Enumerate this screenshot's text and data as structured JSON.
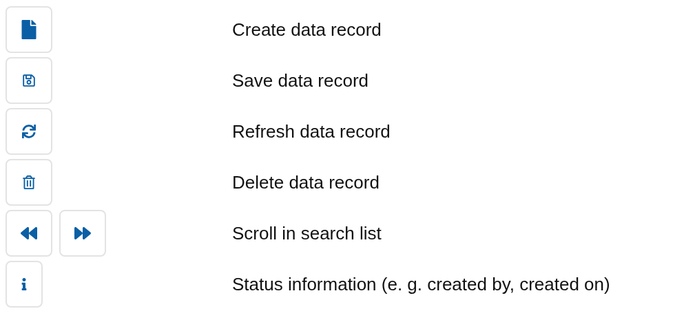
{
  "rows": [
    {
      "buttons": [
        {
          "kind": "new"
        }
      ],
      "label": "Create data record"
    },
    {
      "buttons": [
        {
          "kind": "save"
        }
      ],
      "label": "Save data record"
    },
    {
      "buttons": [
        {
          "kind": "refresh"
        }
      ],
      "label": "Refresh data record"
    },
    {
      "buttons": [
        {
          "kind": "delete"
        }
      ],
      "label": "Delete data record"
    },
    {
      "buttons": [
        {
          "kind": "back"
        },
        {
          "kind": "forward"
        }
      ],
      "label": "Scroll in search list"
    },
    {
      "buttons": [
        {
          "kind": "info"
        }
      ],
      "label": "Status information (e. g. created by, created on)"
    }
  ]
}
